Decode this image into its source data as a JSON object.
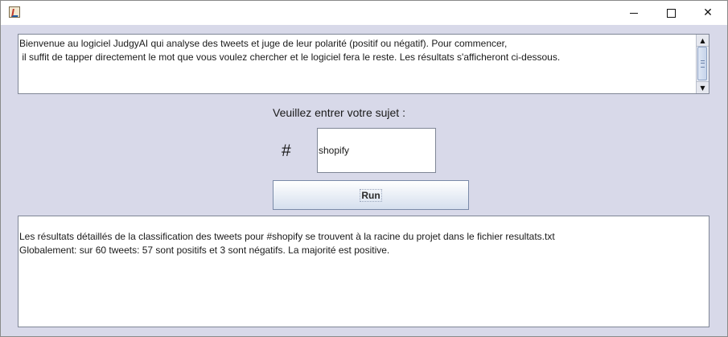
{
  "window": {
    "title": "",
    "controls": {
      "minimize_icon": "minimize-icon",
      "maximize_icon": "maximize-icon",
      "close_icon": "close-icon",
      "close_glyph": "✕"
    },
    "app_icon": "java-app-icon"
  },
  "info": {
    "text": "Bienvenue au logiciel JudgyAI qui analyse des tweets et juge de leur polarité (positif ou négatif). Pour commencer,\n il suffit de tapper directement le mot que vous voulez chercher et le logiciel fera le reste. Les résultats s'afficheront ci-dessous.",
    "scroll_up_glyph": "▲",
    "scroll_down_glyph": "▼"
  },
  "form": {
    "prompt": "Veuillez entrer votre sujet :",
    "hash": "#",
    "subject_value": "shopify",
    "run_label": "Run"
  },
  "results": {
    "text": "Les résultats détaillés de la classification des tweets pour #shopify se trouvent à la racine du projet dans le fichier resultats.txt\nGlobalement: sur 60 tweets: 57 sont positifs et 3 sont négatifs. La majorité est positive."
  },
  "colors": {
    "background": "#d8d9e9",
    "field_border": "#7f8696",
    "button_gradient_end": "#d5dfee"
  }
}
